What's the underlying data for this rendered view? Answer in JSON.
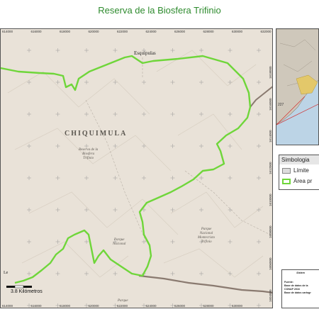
{
  "title": "Reserva de la Biosfera Trifinio",
  "map": {
    "department_label": "CHIQUIMULA",
    "town_label": "Esquipulas",
    "reserve_label": [
      "Reserva de la",
      "Biosfera",
      "Trifinio"
    ],
    "park_montecristo_label": [
      "Parque",
      "Nacional",
      "Montecristo",
      "Trifinio"
    ],
    "park_south_label": [
      "Parque",
      "Nacional"
    ],
    "park_bottom_label": "Parque",
    "corner_label": "Le",
    "x_ticks_top": [
      "614000",
      "616000",
      "618000",
      "620000",
      "622000",
      "624000",
      "626000",
      "628000",
      "630000",
      "632000"
    ],
    "x_ticks_bottom": [
      "614000",
      "616000",
      "618000",
      "620000",
      "622000",
      "624000",
      "626000",
      "628000",
      "630000"
    ],
    "y_ticks_right": [
      "1618000",
      "1616000",
      "1614000",
      "1612000",
      "1610000",
      "1608000",
      "1606000",
      "1604000"
    ],
    "scale_label": "3.8 Kilómetros",
    "colors": {
      "terrain": "#e9e2d8",
      "reserve_boundary": "#6fd63a",
      "international_border": "#8a7a70",
      "graticule": "#9a9a9a"
    }
  },
  "legend": {
    "title": "Simbologia",
    "items": [
      {
        "label": "Límite",
        "swatch": "gray-box"
      },
      {
        "label": "Área pr",
        "swatch": "green-outline-box"
      }
    ]
  },
  "inset": {
    "label": "227"
  },
  "source_box": {
    "heading": "Sistem",
    "lines": [
      "Fuente:",
      "Base de datos de la",
      "CONAP 2016",
      "Base de datos cartogr"
    ]
  }
}
